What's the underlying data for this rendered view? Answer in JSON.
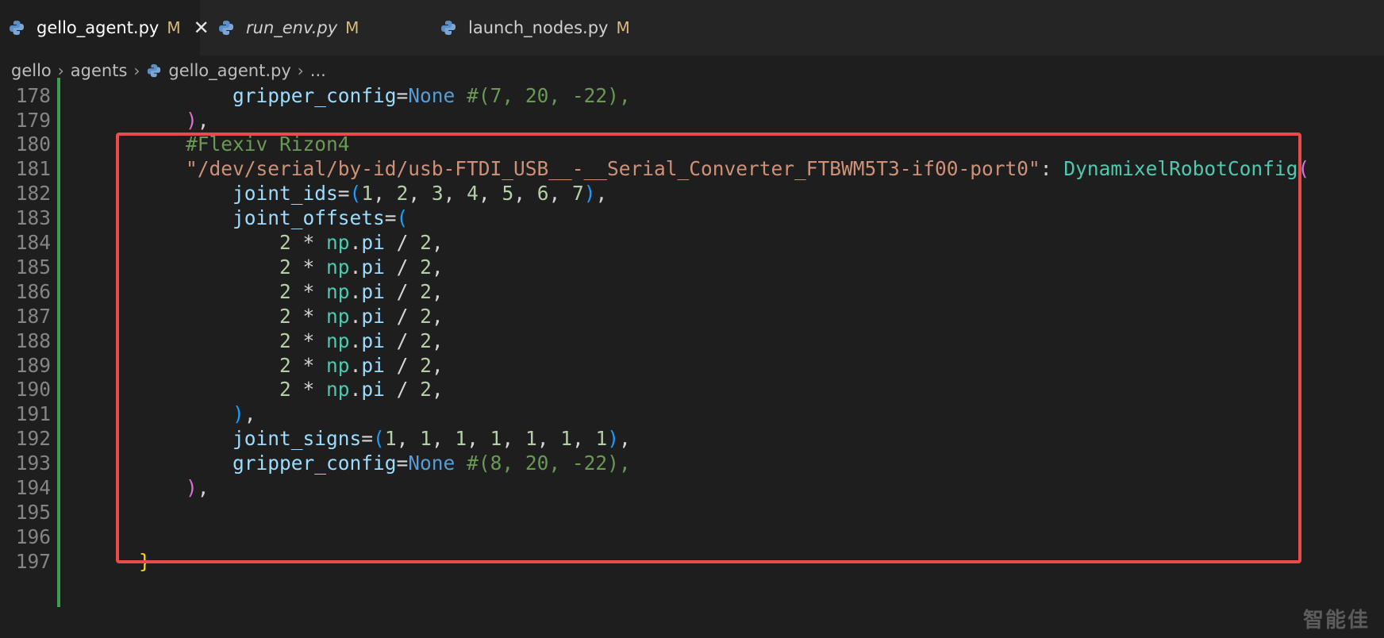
{
  "tabs": [
    {
      "name": "gello_agent.py",
      "status": "M",
      "close": "✕",
      "italic": false,
      "active": true
    },
    {
      "name": "run_env.py",
      "status": "M",
      "italic": true,
      "active": false
    },
    {
      "name": "launch_nodes.py",
      "status": "M",
      "italic": false,
      "active": false
    }
  ],
  "breadcrumb": {
    "items": [
      "gello",
      "agents",
      "gello_agent.py",
      "..."
    ],
    "separator": "›"
  },
  "editor": {
    "lines": [
      {
        "num": "178",
        "segments": [
          {
            "t": "            "
          },
          {
            "t": "gripper_config",
            "c": "param"
          },
          {
            "t": "="
          },
          {
            "t": "None",
            "c": "kw"
          },
          {
            "t": " "
          },
          {
            "t": "#(7, 20, -22),",
            "c": "cmt"
          }
        ]
      },
      {
        "num": "179",
        "segments": [
          {
            "t": "        "
          },
          {
            "t": ")",
            "c": "b2"
          },
          {
            "t": ","
          }
        ]
      },
      {
        "num": "180",
        "segments": [
          {
            "t": "        "
          },
          {
            "t": "#Flexiv Rizon4",
            "c": "cmt"
          }
        ]
      },
      {
        "num": "181",
        "segments": [
          {
            "t": "        "
          },
          {
            "t": "\"/dev/serial/by-id/usb-FTDI_USB__-__Serial_Converter_FTBWM5T3-if00-port0\"",
            "c": "str"
          },
          {
            "t": ": "
          },
          {
            "t": "DynamixelRobotConfig",
            "c": "cls"
          },
          {
            "t": "(",
            "c": "b2"
          }
        ]
      },
      {
        "num": "182",
        "segments": [
          {
            "t": "            "
          },
          {
            "t": "joint_ids",
            "c": "param"
          },
          {
            "t": "="
          },
          {
            "t": "(",
            "c": "b1"
          },
          {
            "t": "1",
            "c": "num"
          },
          {
            "t": ", "
          },
          {
            "t": "2",
            "c": "num"
          },
          {
            "t": ", "
          },
          {
            "t": "3",
            "c": "num"
          },
          {
            "t": ", "
          },
          {
            "t": "4",
            "c": "num"
          },
          {
            "t": ", "
          },
          {
            "t": "5",
            "c": "num"
          },
          {
            "t": ", "
          },
          {
            "t": "6",
            "c": "num"
          },
          {
            "t": ", "
          },
          {
            "t": "7",
            "c": "num"
          },
          {
            "t": ")",
            "c": "b1"
          },
          {
            "t": ","
          }
        ]
      },
      {
        "num": "183",
        "segments": [
          {
            "t": "            "
          },
          {
            "t": "joint_offsets",
            "c": "param"
          },
          {
            "t": "="
          },
          {
            "t": "(",
            "c": "b1"
          }
        ]
      },
      {
        "num": "184",
        "segments": [
          {
            "t": "                "
          },
          {
            "t": "2",
            "c": "num"
          },
          {
            "t": " * "
          },
          {
            "t": "np",
            "c": "np"
          },
          {
            "t": "."
          },
          {
            "t": "pi",
            "c": "param"
          },
          {
            "t": " / "
          },
          {
            "t": "2",
            "c": "num"
          },
          {
            "t": ","
          }
        ]
      },
      {
        "num": "185",
        "segments": [
          {
            "t": "                "
          },
          {
            "t": "2",
            "c": "num"
          },
          {
            "t": " * "
          },
          {
            "t": "np",
            "c": "np"
          },
          {
            "t": "."
          },
          {
            "t": "pi",
            "c": "param"
          },
          {
            "t": " / "
          },
          {
            "t": "2",
            "c": "num"
          },
          {
            "t": ","
          }
        ]
      },
      {
        "num": "186",
        "segments": [
          {
            "t": "                "
          },
          {
            "t": "2",
            "c": "num"
          },
          {
            "t": " * "
          },
          {
            "t": "np",
            "c": "np"
          },
          {
            "t": "."
          },
          {
            "t": "pi",
            "c": "param"
          },
          {
            "t": " / "
          },
          {
            "t": "2",
            "c": "num"
          },
          {
            "t": ","
          }
        ]
      },
      {
        "num": "187",
        "segments": [
          {
            "t": "                "
          },
          {
            "t": "2",
            "c": "num"
          },
          {
            "t": " * "
          },
          {
            "t": "np",
            "c": "np"
          },
          {
            "t": "."
          },
          {
            "t": "pi",
            "c": "param"
          },
          {
            "t": " / "
          },
          {
            "t": "2",
            "c": "num"
          },
          {
            "t": ","
          }
        ]
      },
      {
        "num": "188",
        "segments": [
          {
            "t": "                "
          },
          {
            "t": "2",
            "c": "num"
          },
          {
            "t": " * "
          },
          {
            "t": "np",
            "c": "np"
          },
          {
            "t": "."
          },
          {
            "t": "pi",
            "c": "param"
          },
          {
            "t": " / "
          },
          {
            "t": "2",
            "c": "num"
          },
          {
            "t": ","
          }
        ]
      },
      {
        "num": "189",
        "segments": [
          {
            "t": "                "
          },
          {
            "t": "2",
            "c": "num"
          },
          {
            "t": " * "
          },
          {
            "t": "np",
            "c": "np"
          },
          {
            "t": "."
          },
          {
            "t": "pi",
            "c": "param"
          },
          {
            "t": " / "
          },
          {
            "t": "2",
            "c": "num"
          },
          {
            "t": ","
          }
        ]
      },
      {
        "num": "190",
        "segments": [
          {
            "t": "                "
          },
          {
            "t": "2",
            "c": "num"
          },
          {
            "t": " * "
          },
          {
            "t": "np",
            "c": "np"
          },
          {
            "t": "."
          },
          {
            "t": "pi",
            "c": "param"
          },
          {
            "t": " / "
          },
          {
            "t": "2",
            "c": "num"
          },
          {
            "t": ","
          }
        ]
      },
      {
        "num": "191",
        "segments": [
          {
            "t": "            "
          },
          {
            "t": ")",
            "c": "b1"
          },
          {
            "t": ","
          }
        ]
      },
      {
        "num": "192",
        "segments": [
          {
            "t": "            "
          },
          {
            "t": "joint_signs",
            "c": "param"
          },
          {
            "t": "="
          },
          {
            "t": "(",
            "c": "b1"
          },
          {
            "t": "1",
            "c": "num"
          },
          {
            "t": ", "
          },
          {
            "t": "1",
            "c": "num"
          },
          {
            "t": ", "
          },
          {
            "t": "1",
            "c": "num"
          },
          {
            "t": ", "
          },
          {
            "t": "1",
            "c": "num"
          },
          {
            "t": ", "
          },
          {
            "t": "1",
            "c": "num"
          },
          {
            "t": ", "
          },
          {
            "t": "1",
            "c": "num"
          },
          {
            "t": ", "
          },
          {
            "t": "1",
            "c": "num"
          },
          {
            "t": ")",
            "c": "b1"
          },
          {
            "t": ","
          }
        ]
      },
      {
        "num": "193",
        "segments": [
          {
            "t": "            "
          },
          {
            "t": "gripper_config",
            "c": "param"
          },
          {
            "t": "="
          },
          {
            "t": "None",
            "c": "kw"
          },
          {
            "t": " "
          },
          {
            "t": "#(8, 20, -22),",
            "c": "cmt"
          }
        ]
      },
      {
        "num": "194",
        "segments": [
          {
            "t": "        "
          },
          {
            "t": ")",
            "c": "b2"
          },
          {
            "t": ","
          }
        ]
      },
      {
        "num": "195",
        "segments": []
      },
      {
        "num": "196",
        "segments": []
      },
      {
        "num": "197",
        "segments": [
          {
            "t": "    "
          },
          {
            "t": "}",
            "c": "b3"
          }
        ]
      }
    ]
  },
  "watermark": "智能佳",
  "colors": {
    "highlight_box": "#e84b4b",
    "modified_indicator": "#d7ba7d",
    "git_gutter": "#3e9e52"
  },
  "icons": {
    "tab_file": "python-icon",
    "breadcrumb_file": "python-icon"
  }
}
